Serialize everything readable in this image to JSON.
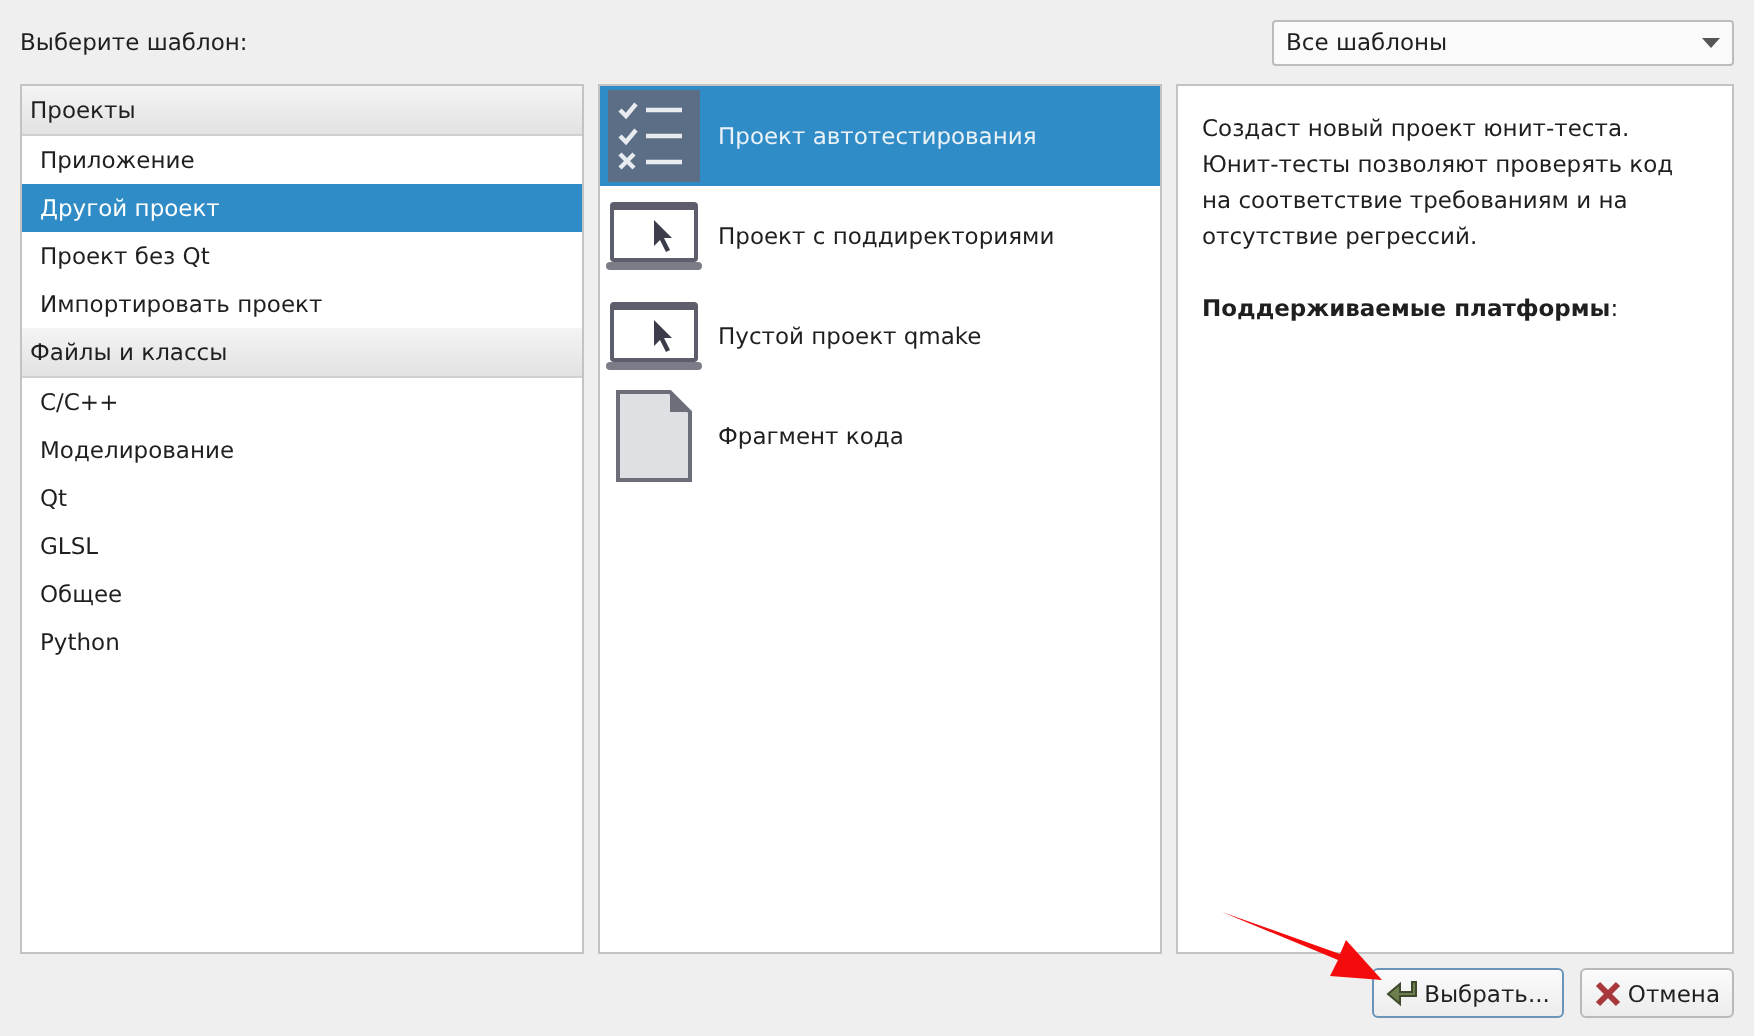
{
  "header": {
    "label": "Выберите шаблон:",
    "filter": {
      "value": "Все шаблоны"
    }
  },
  "categories": [
    {
      "kind": "header",
      "label": "Проекты"
    },
    {
      "kind": "item",
      "label": "Приложение",
      "selected": false
    },
    {
      "kind": "item",
      "label": "Другой проект",
      "selected": true
    },
    {
      "kind": "item",
      "label": "Проект без Qt",
      "selected": false
    },
    {
      "kind": "item",
      "label": "Импортировать проект",
      "selected": false
    },
    {
      "kind": "header",
      "label": "Файлы и классы"
    },
    {
      "kind": "item",
      "label": "C/C++",
      "selected": false
    },
    {
      "kind": "item",
      "label": "Моделирование",
      "selected": false
    },
    {
      "kind": "item",
      "label": "Qt",
      "selected": false
    },
    {
      "kind": "item",
      "label": "GLSL",
      "selected": false
    },
    {
      "kind": "item",
      "label": "Общее",
      "selected": false
    },
    {
      "kind": "item",
      "label": "Python",
      "selected": false
    }
  ],
  "templates": [
    {
      "kind": "checklist",
      "label": "Проект автотестирования",
      "selected": true
    },
    {
      "kind": "laptop",
      "label": "Проект с поддиректориями",
      "selected": false
    },
    {
      "kind": "laptop",
      "label": "Пустой проект qmake",
      "selected": false
    },
    {
      "kind": "file",
      "label": "Фрагмент кода",
      "selected": false
    }
  ],
  "description": {
    "text": "Создаст новый проект юнит-теста. Юнит-тесты позволяют проверять код на соответствие требованиям и на отсутствие регрессий.",
    "platforms": "**Поддерживаемые платформы**:"
  },
  "buttons": [
    {
      "kind": "choose",
      "label": "Выбрать..."
    },
    {
      "kind": "cancel",
      "label": "Отмена"
    }
  ],
  "annotation": {
    "kind": "arrow"
  }
}
